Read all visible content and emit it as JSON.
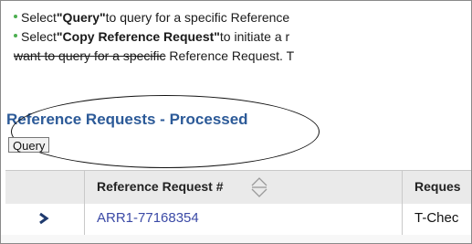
{
  "instructions": {
    "line1_prefix": "Select ",
    "line1_bold": "\"Query\"",
    "line1_suffix": " to query for a specific Reference",
    "line2_prefix": "Select ",
    "line2_bold": "\"Copy Reference Request\"",
    "line2_suffix": " to initiate a r",
    "line3_struck": "want to query for a specific",
    "line3_rest": " Reference Request. T"
  },
  "section": {
    "title": "Reference Requests - Processed",
    "query_label": "Query"
  },
  "table": {
    "headers": [
      "Reference Request #",
      "Reques"
    ],
    "rows": [
      {
        "ref": "ARR1-77168354",
        "req": "T-Chec"
      }
    ]
  },
  "colors": {
    "title": "#2c5a98",
    "link": "#3b4aa6",
    "bullet": "#4caf50",
    "header_bg": "#eaeaea"
  }
}
